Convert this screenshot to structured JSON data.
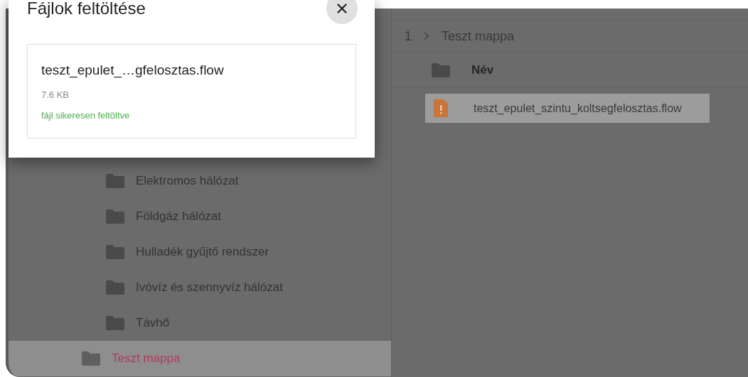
{
  "sidebar": {
    "folders": [
      {
        "children": [
          {
            "label": "Elektromos hálózat",
            "selected": false
          },
          {
            "label": "Földgáz hálózat",
            "selected": false
          },
          {
            "label": "Hulladék gyűjtő rendszer",
            "selected": false
          },
          {
            "label": "Ivóvíz és szennyvíz hálózat",
            "selected": false
          },
          {
            "label": "Távhő",
            "selected": false
          }
        ]
      },
      {
        "label": "Teszt mappa",
        "selected": true
      }
    ]
  },
  "breadcrumb": [
    "1",
    "Teszt mappa"
  ],
  "table": {
    "columns": [
      "Név"
    ],
    "rows": [
      {
        "name": "teszt_epulet_szintu_koltsegfelosztas.flow",
        "kind": "warning",
        "selected": true
      }
    ]
  },
  "dialog": {
    "title": "Fájlok feltöltése",
    "uploads": [
      {
        "name": "teszt_epulet_…gfelosztas.flow",
        "size": "7.6 KB",
        "status": "fájl sikeresen feltöltve",
        "kind": "success"
      }
    ]
  }
}
